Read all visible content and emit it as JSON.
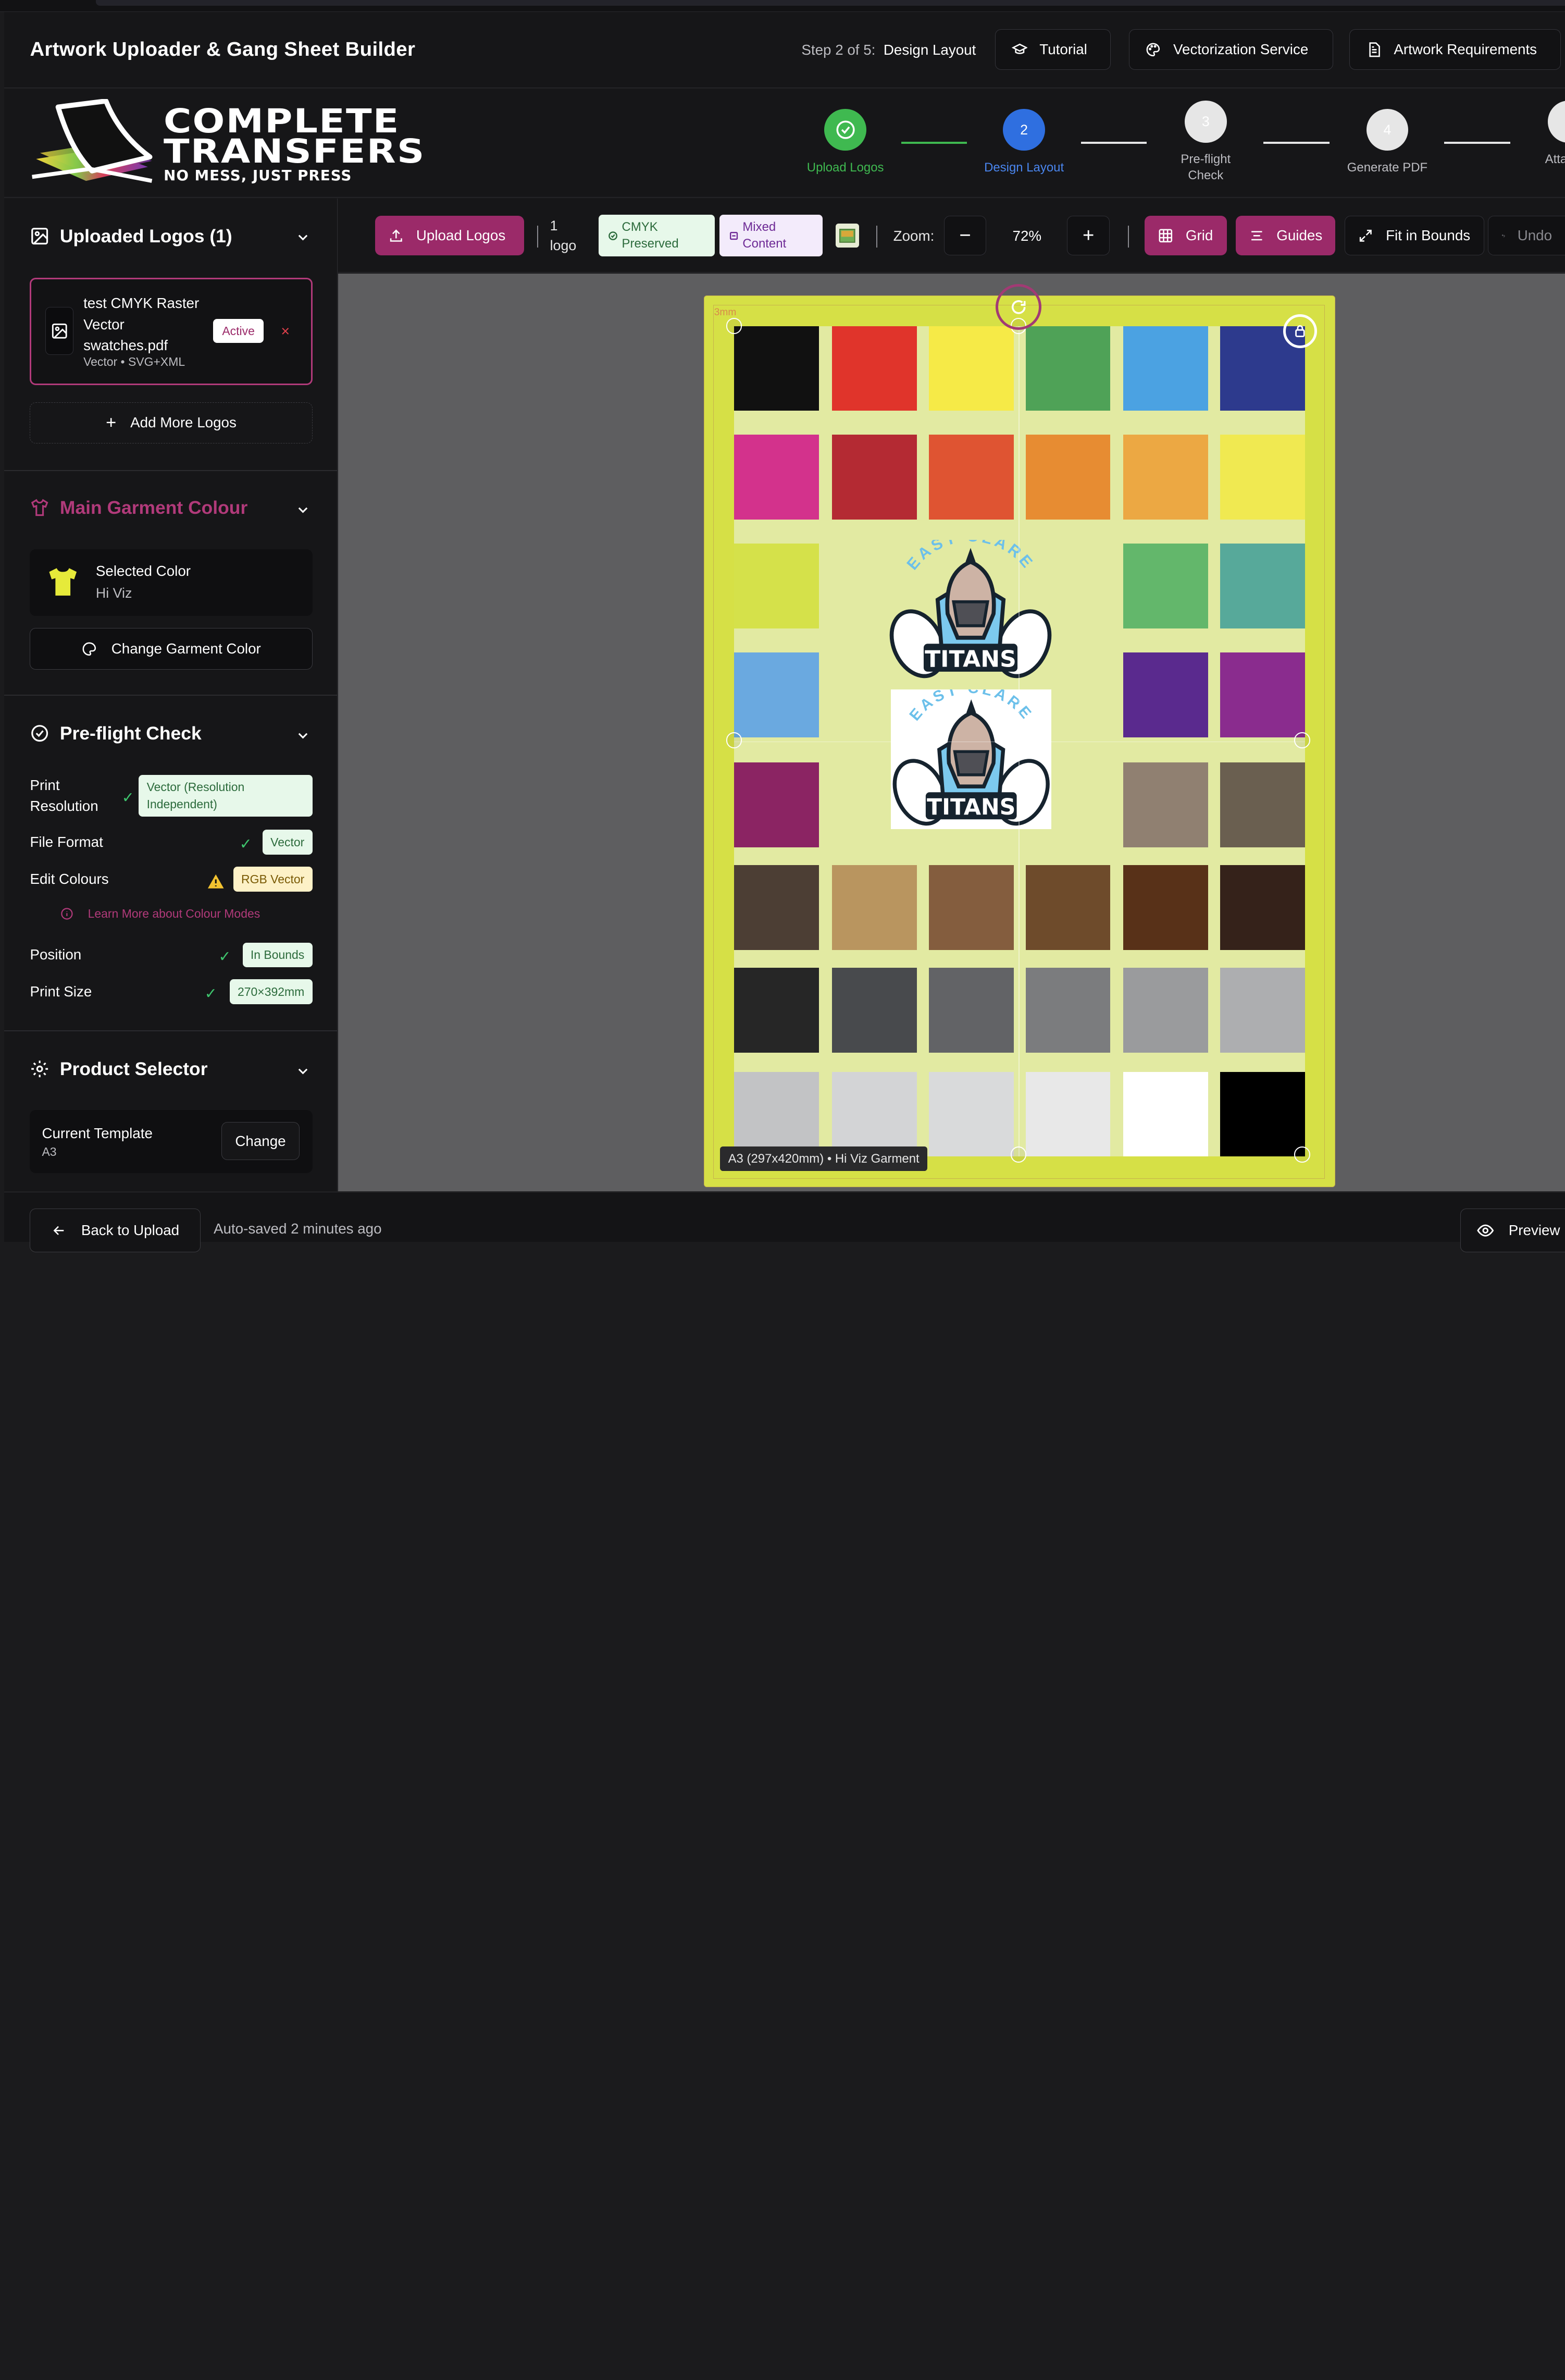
{
  "header": {
    "title": "Artwork Uploader & Gang Sheet Builder",
    "step_prefix": "Step 2 of 5:",
    "step_name": "Design Layout",
    "buttons": {
      "tutorial": "Tutorial",
      "vectorization": "Vectorization Service",
      "requirements": "Artwork Requirements"
    }
  },
  "brand": {
    "line1": "COMPLETE",
    "line2": "TRANSFERS",
    "tagline": "NO MESS, JUST PRESS"
  },
  "stepper": {
    "steps": [
      {
        "label": "Upload Logos",
        "state": "complete",
        "number": ""
      },
      {
        "label": "Design Layout",
        "state": "active",
        "number": "2"
      },
      {
        "label": "Pre-flight Check",
        "state": "pending",
        "number": "3"
      },
      {
        "label": "Generate PDF",
        "state": "pending",
        "number": "4"
      },
      {
        "label": "Atta O",
        "state": "pending",
        "number": ""
      }
    ],
    "colors": {
      "complete": "#3fb950",
      "active": "#2f6fe0",
      "pending": "#e6e6e6"
    }
  },
  "sidebar": {
    "uploaded": {
      "title": "Uploaded Logos (1)",
      "file_name": "test CMYK Raster Vector swatches.pdf",
      "file_meta": "Vector • SVG+XML",
      "badge": "Active",
      "remove": "×",
      "add_more": "Add More Logos"
    },
    "garment": {
      "title": "Main Garment Colour",
      "selected_label": "Selected Color",
      "selected_value": "Hi Viz",
      "change_button": "Change Garment Color",
      "swatch": "#e6ea3a"
    },
    "preflight": {
      "title": "Pre-flight Check",
      "rows": [
        {
          "label": "Print Resolution",
          "badge": "Vector (Resolution Independent)",
          "status": "ok"
        },
        {
          "label": "File Format",
          "badge": "Vector",
          "status": "ok"
        },
        {
          "label": "Edit Colours",
          "badge": "RGB Vector",
          "status": "warn"
        },
        {
          "label": "Position",
          "badge": "In Bounds",
          "status": "ok"
        },
        {
          "label": "Print Size",
          "badge": "270×392mm",
          "status": "ok"
        }
      ],
      "learn_more": "Learn More about Colour Modes"
    },
    "product": {
      "title": "Product Selector",
      "template_label": "Current Template",
      "template_value": "A3",
      "change": "Change"
    }
  },
  "toolbar": {
    "upload": "Upload Logos",
    "count_num": "1",
    "count_word": "logo",
    "cmyk_1": "CMYK",
    "cmyk_2": "Preserved",
    "mixed_1": "Mixed",
    "mixed_2": "Content",
    "zoom_label": "Zoom:",
    "zoom_minus": "−",
    "zoom_value": "72%",
    "zoom_plus": "+",
    "grid": "Grid",
    "guides": "Guides",
    "fit": "Fit in Bounds",
    "undo": "Undo"
  },
  "canvas": {
    "bleed_label": "3mm",
    "size_label": "A3 (297x420mm) • Hi Viz Garment",
    "logo_top": "EAST CLARE",
    "logo_name": "TITANS",
    "swatch_rows": [
      [
        "#111111",
        "#e0342b",
        "#f6ea47",
        "#4fa257",
        "#4ba2e2",
        "#2d3a8d"
      ],
      [
        "#d3328c",
        "#b42a33",
        "#df5432",
        "#e78c32",
        "#eca843",
        "#f0e951"
      ],
      [
        "#d5e14a",
        "",
        "",
        "",
        "#63b76b",
        "#57a99a"
      ],
      [
        "#6aa9e0",
        "",
        "",
        "",
        "#5a2a8e",
        "#8a2c8e"
      ],
      [
        "#8b2463",
        "",
        "",
        "",
        "#908071",
        "#6a5f50"
      ],
      [
        "#4c3e34",
        "#b9955f",
        "#845d3e",
        "#6e4b2b",
        "#583118",
        "#35221a"
      ],
      [
        "#262626",
        "#484a4d",
        "#626366",
        "#7b7c7e",
        "#9a9b9d",
        "#adaeb0"
      ],
      [
        "#c2c3c5",
        "#d3d4d6",
        "#d9dadb",
        "#e8e8e8",
        "#ffffff",
        "#000000"
      ]
    ]
  },
  "footer": {
    "back": "Back to Upload",
    "autosave": "Auto-saved 2 minutes ago",
    "preview": "Preview"
  }
}
